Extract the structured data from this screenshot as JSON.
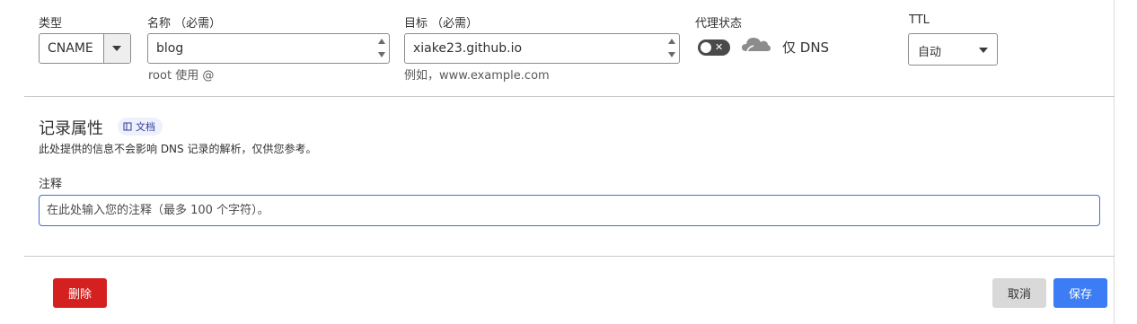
{
  "fields": {
    "type": {
      "label": "类型",
      "value": "CNAME"
    },
    "name": {
      "label": "名称 （必需）",
      "value": "blog",
      "hint": "root 使用 @"
    },
    "target": {
      "label": "目标 （必需）",
      "value": "xiake23.github.io",
      "hint": "例如，www.example.com"
    },
    "proxy": {
      "label": "代理状态",
      "toggle_glyph": "✕",
      "status_text": "仅 DNS",
      "icon": "cloud-icon"
    },
    "ttl": {
      "label": "TTL",
      "value": "自动"
    }
  },
  "record_attributes": {
    "title": "记录属性",
    "doc_badge": "文档",
    "description": "此处提供的信息不会影响 DNS 记录的解析，仅供您参考。",
    "note_label": "注释",
    "note_placeholder": "在此处输入您的注释（最多 100 个字符）。"
  },
  "actions": {
    "delete": "删除",
    "cancel": "取消",
    "save": "保存"
  },
  "colors": {
    "delete": "#d52020",
    "save": "#3c7cf4",
    "cancel": "#d9d9d9",
    "focus_border": "#3f6fd1"
  }
}
